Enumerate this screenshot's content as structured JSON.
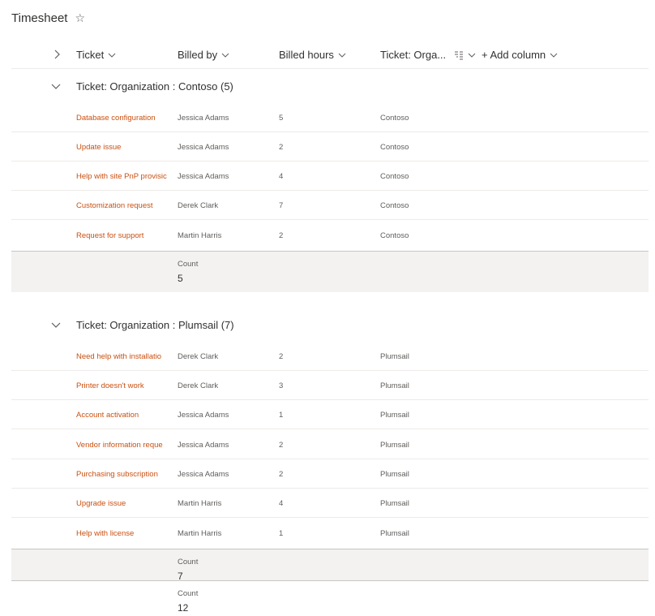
{
  "page": {
    "title": "Timesheet"
  },
  "columns": [
    {
      "label": "Ticket"
    },
    {
      "label": "Billed by"
    },
    {
      "label": "Billed hours"
    },
    {
      "label": "Ticket: Orga..."
    },
    {
      "label": "+ Add column"
    }
  ],
  "groups": [
    {
      "title": "Ticket: Organization : Contoso (5)",
      "rows": [
        {
          "ticket": "Database configuration",
          "billed_by": "Jessica Adams",
          "hours": "5",
          "org": "Contoso"
        },
        {
          "ticket": "Update issue",
          "billed_by": "Jessica Adams",
          "hours": "2",
          "org": "Contoso"
        },
        {
          "ticket": "Help with site PnP provisic",
          "billed_by": "Jessica Adams",
          "hours": "4",
          "org": "Contoso"
        },
        {
          "ticket": "Customization request",
          "billed_by": "Derek Clark",
          "hours": "7",
          "org": "Contoso"
        },
        {
          "ticket": "Request for support",
          "billed_by": "Martin Harris",
          "hours": "2",
          "org": "Contoso"
        }
      ],
      "footer": {
        "label": "Count",
        "value": "5"
      }
    },
    {
      "title": "Ticket: Organization : Plumsail (7)",
      "rows": [
        {
          "ticket": "Need help with installatio",
          "billed_by": "Derek Clark",
          "hours": "2",
          "org": "Plumsail"
        },
        {
          "ticket": "Printer doesn't work",
          "billed_by": "Derek Clark",
          "hours": "3",
          "org": "Plumsail"
        },
        {
          "ticket": "Account activation",
          "billed_by": "Jessica Adams",
          "hours": "1",
          "org": "Plumsail"
        },
        {
          "ticket": "Vendor information reque",
          "billed_by": "Jessica Adams",
          "hours": "2",
          "org": "Plumsail"
        },
        {
          "ticket": "Purchasing subscription",
          "billed_by": "Jessica Adams",
          "hours": "2",
          "org": "Plumsail"
        },
        {
          "ticket": "Upgrade issue",
          "billed_by": "Martin Harris",
          "hours": "4",
          "org": "Plumsail"
        },
        {
          "ticket": "Help with license",
          "billed_by": "Martin Harris",
          "hours": "1",
          "org": "Plumsail"
        }
      ],
      "footer": {
        "label": "Count",
        "value": "7"
      }
    }
  ],
  "grand_total": {
    "label": "Count",
    "value": "12"
  },
  "colors": {
    "link": "#ca5010",
    "footer_bg": "#f3f2f1",
    "divider": "#edebe9"
  },
  "icons": {
    "favorite": "star-icon",
    "expand": "chevron-right-icon",
    "collapse": "chevron-down-icon",
    "grouped": "group-by-icon"
  }
}
